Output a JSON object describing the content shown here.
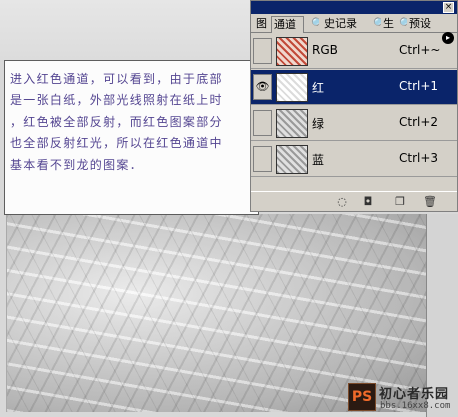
{
  "note_text": "进入红色通道，可以看到，由于底部\n是一张白纸，外部光线照射在纸上时\n，红色被全部反射，而红色图案部分\n也全部反射红光，所以在红色通道中\n基本看不到龙的图案．",
  "panel": {
    "tabs": [
      {
        "label": "图"
      },
      {
        "label": "通道"
      },
      {
        "label": "史记录"
      },
      {
        "label": "生"
      },
      {
        "label": "预设"
      }
    ],
    "channels": [
      {
        "name": "RGB",
        "shortcut": "Ctrl+~",
        "visible": false,
        "selected": false,
        "thumb": "rgb"
      },
      {
        "name": "红",
        "shortcut": "Ctrl+1",
        "visible": true,
        "selected": true,
        "thumb": "red"
      },
      {
        "name": "绿",
        "shortcut": "Ctrl+2",
        "visible": false,
        "selected": false,
        "thumb": "green"
      },
      {
        "name": "蓝",
        "shortcut": "Ctrl+3",
        "visible": false,
        "selected": false,
        "thumb": "blue"
      }
    ],
    "footer_icons": [
      "load-selection-icon",
      "save-selection-icon",
      "new-channel-icon",
      "delete-channel-icon"
    ]
  },
  "watermark": {
    "logo": "PS",
    "title": "初心者乐园",
    "url": "bbs.16xx8.com"
  },
  "colors": {
    "text": "#4a3a8c",
    "selection": "#0a246a",
    "panel_bg": "#d4d0c8"
  }
}
